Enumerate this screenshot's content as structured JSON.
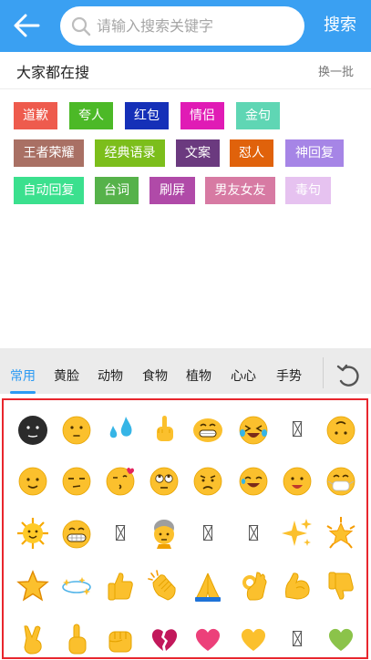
{
  "header": {
    "search_placeholder": "请输入搜索关键字",
    "search_button": "搜索",
    "accent_color": "#3aa0f2"
  },
  "hot": {
    "title": "大家都在搜",
    "refresh": "换一批",
    "tags": [
      {
        "label": "道歉",
        "color": "#ee5b4d"
      },
      {
        "label": "夸人",
        "color": "#4cb927"
      },
      {
        "label": "红包",
        "color": "#1530b8"
      },
      {
        "label": "情侣",
        "color": "#e01bb5"
      },
      {
        "label": "金句",
        "color": "#5fd6b4"
      },
      {
        "label": "王者荣耀",
        "color": "#a97064"
      },
      {
        "label": "经典语录",
        "color": "#7cbe1b"
      },
      {
        "label": "文案",
        "color": "#6b3a7f"
      },
      {
        "label": "怼人",
        "color": "#e0620b"
      },
      {
        "label": "神回复",
        "color": "#a685e6"
      },
      {
        "label": "自动回复",
        "color": "#3be08e"
      },
      {
        "label": "台词",
        "color": "#56b24a"
      },
      {
        "label": "刷屏",
        "color": "#b04aa8"
      },
      {
        "label": "男友女友",
        "color": "#d77aa3"
      },
      {
        "label": "毒句",
        "color": "#e6c2f0"
      }
    ]
  },
  "emoji_panel": {
    "tabs": [
      "常用",
      "黄脸",
      "动物",
      "食物",
      "植物",
      "心心",
      "手势"
    ],
    "active_tab": "常用",
    "grid": [
      [
        "dark-face-icon",
        "eyeroll-face-icon",
        "sweat-drops-icon",
        "middle-finger-icon",
        "grin-face-icon",
        "laugh-tears-face-icon",
        "missing-glyph-icon",
        "upside-smile-face-icon"
      ],
      [
        "slight-smile-face-icon",
        "unamused-face-icon",
        "kiss-heart-face-icon",
        "rolling-eyes-face-icon",
        "confused-face-icon",
        "joy-face-icon",
        "open-mouth-face-icon",
        "mask-face-icon"
      ],
      [
        "sun-face-icon",
        "grimace-face-icon",
        "missing-glyph-icon",
        "old-man-icon",
        "missing-glyph-icon",
        "missing-glyph-icon",
        "sparkles-icon",
        "glowing-star-icon"
      ],
      [
        "star-icon",
        "dizzy-icon",
        "thumbs-up-icon",
        "clapping-hands-icon",
        "folded-hands-icon",
        "ok-hand-icon",
        "flexed-bicep-icon",
        "thumbs-down-icon"
      ],
      [
        "victory-hand-icon",
        "pointing-up-icon",
        "fist-icon",
        "broken-heart-icon",
        "pink-heart-icon",
        "yellow-heart-icon",
        "missing-glyph-icon",
        "green-heart-icon"
      ]
    ]
  }
}
